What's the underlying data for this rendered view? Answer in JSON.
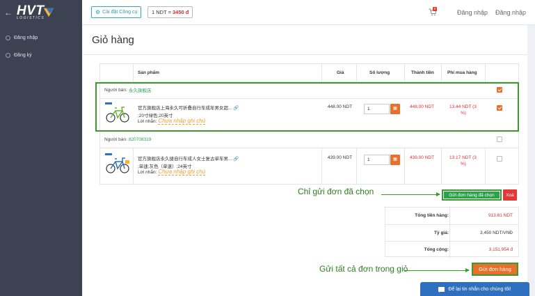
{
  "app": {
    "logo_main": "HVT",
    "logo_sub": "LOGISTICS"
  },
  "sidebar": {
    "items": [
      {
        "label": "Đăng nhập",
        "icon": "user-icon"
      },
      {
        "label": "Đăng ký",
        "icon": "register-icon"
      }
    ]
  },
  "topbar": {
    "tool_button": "Cài đặt Công cụ",
    "rate_prefix": "1 NDT =",
    "rate_value": "3450 đ",
    "cart_count": "0",
    "link_login": "Đăng nhập",
    "link_register": "Đăng nhập"
  },
  "page": {
    "title": "Giỏ hàng"
  },
  "table": {
    "headers": [
      "Sản phẩm",
      "Giá",
      "Số lượng",
      "Thành tiền",
      "Phí mua hàng"
    ],
    "seller_label": "Người bán:",
    "note_label": "Lời nhắn:",
    "note_hint": "Chưa nhập ghi chú",
    "groups": [
      {
        "seller": "永久旗舰店",
        "checked": true,
        "product": {
          "name": "官方旗舰店上海永久可折叠自行车成年男女超...",
          "variant": ";20寸绿色;20英寸",
          "price": "448.00 NDT",
          "quantity": "1",
          "total": "448.00 NDT",
          "fee_line1": "13.44 NDT (3",
          "fee_line2": "%)",
          "checked": true
        }
      },
      {
        "seller": "820708319",
        "checked": false,
        "product": {
          "name": "官方旗舰店永久捷自行车成人女士复古单车男...",
          "variant": ";单速;灰色（单速）;24英寸",
          "price": "439.00 NDT",
          "quantity": "1",
          "total": "439.00 NDT",
          "fee_line1": "13.17 NDT (3",
          "fee_line2": "%)",
          "checked": false
        }
      }
    ]
  },
  "actions": {
    "annotation_selected": "Chỉ gửi đơn đã chọn",
    "send_selected": "Gửi đơn hàng đã chọn",
    "delete": "Xoá",
    "annotation_all": "Gửi tất cả đơn trong giỏ",
    "send_all": "Gửi đơn hàng"
  },
  "summary": {
    "rows": [
      {
        "label": "Tổng tiền hàng:",
        "value": "913.61 NDT",
        "color": "#e02b2b"
      },
      {
        "label": "Tỷ giá:",
        "value": "3,450 NDT/VNĐ",
        "color": "#333333"
      },
      {
        "label": "Tổng cộng:",
        "value": "3,151,954 đ",
        "color": "#e02b2b"
      }
    ]
  },
  "chat": {
    "label": "Để lại tin nhắn cho chúng tôi!"
  },
  "colors": {
    "sidebar": "#3c4251",
    "accent_orange": "#e8702d",
    "accent_green": "#2aa24a",
    "annotation_green": "#3c9a2d",
    "price_red": "#e02b2b",
    "chat_blue": "#2f6fc0"
  }
}
